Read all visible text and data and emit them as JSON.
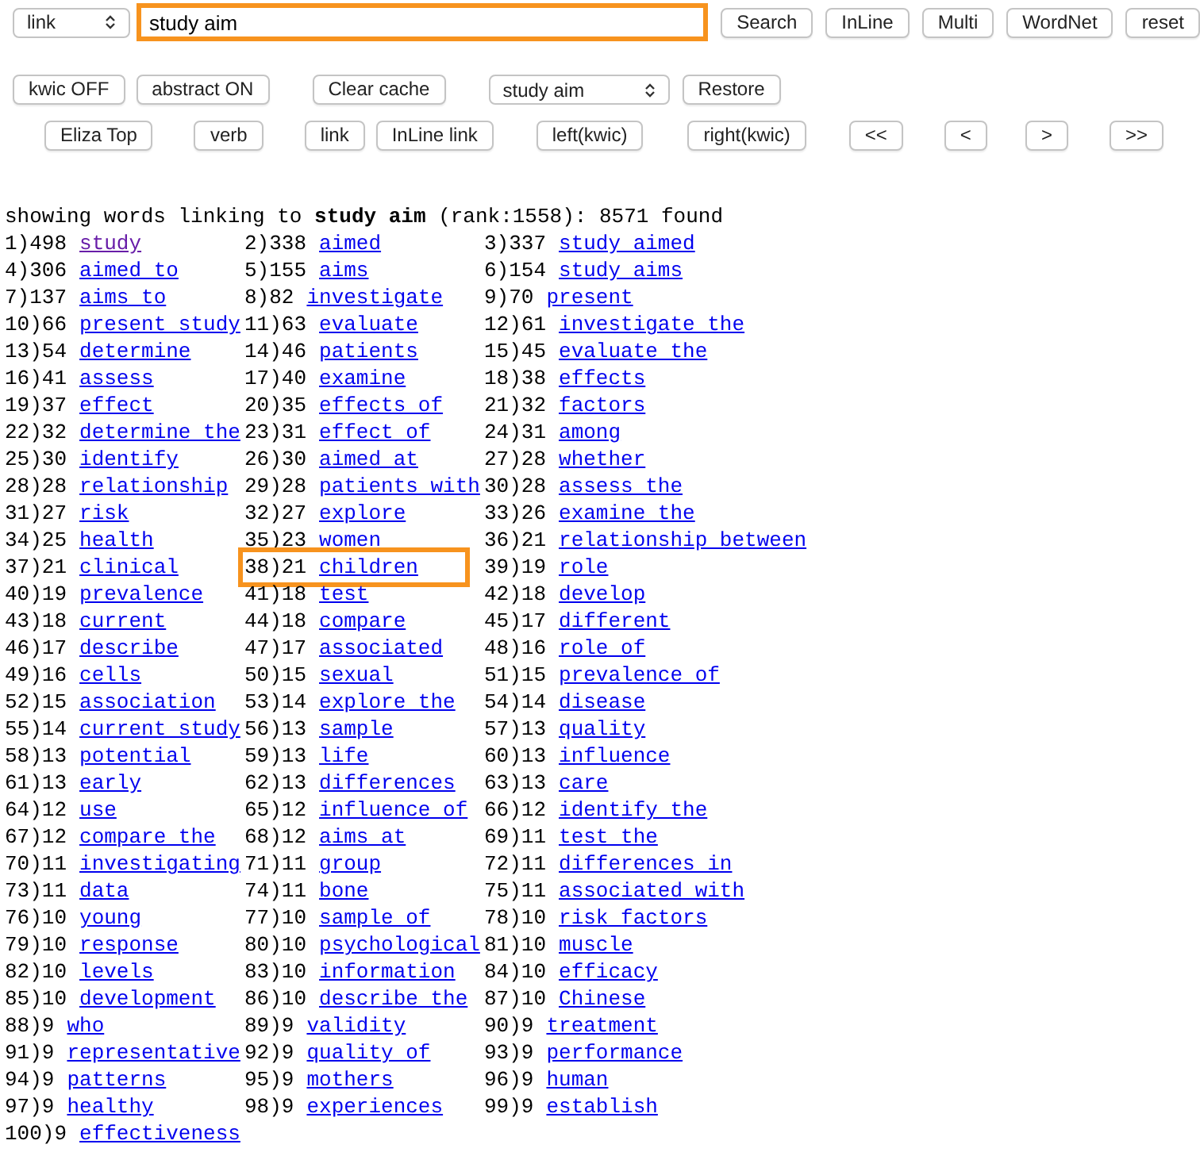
{
  "toolbar": {
    "mode_select": {
      "value": "link"
    },
    "search_field": {
      "value": "study aim",
      "highlighted": true
    },
    "buttons": [
      "Search",
      "InLine",
      "Multi",
      "WordNet",
      "reset"
    ]
  },
  "row2": [
    {
      "kind": "button",
      "label": "kwic OFF"
    },
    {
      "kind": "button",
      "label": "abstract ON"
    },
    {
      "kind": "button",
      "label": "Clear cache"
    },
    {
      "kind": "select",
      "label": "study aim"
    },
    {
      "kind": "button",
      "label": "Restore"
    }
  ],
  "row3": [
    "Eliza Top",
    "verb",
    "link",
    "InLine link",
    "left(kwic)",
    "right(kwic)",
    "<<",
    "<",
    ">",
    ">>"
  ],
  "results": {
    "heading": "showing words linking to **study aim** (rank:1558): 8571 found",
    "items": [
      {
        "num": "1)498",
        "word": "study",
        "visited": true,
        "highlighted": false
      },
      {
        "num": "2)338",
        "word": "aimed",
        "visited": false,
        "highlighted": false
      },
      {
        "num": "3)337",
        "word": "study aimed",
        "visited": false,
        "highlighted": false
      },
      {
        "num": "4)306",
        "word": "aimed to",
        "visited": false,
        "highlighted": false
      },
      {
        "num": "5)155",
        "word": "aims",
        "visited": false,
        "highlighted": false
      },
      {
        "num": "6)154",
        "word": "study aims",
        "visited": false,
        "highlighted": false
      },
      {
        "num": "7)137",
        "word": "aims to",
        "visited": false,
        "highlighted": false
      },
      {
        "num": "8)82",
        "word": "investigate",
        "visited": false,
        "highlighted": false
      },
      {
        "num": "9)70",
        "word": "present",
        "visited": false,
        "highlighted": false
      },
      {
        "num": "10)66",
        "word": "present study",
        "visited": false,
        "highlighted": false
      },
      {
        "num": "11)63",
        "word": "evaluate",
        "visited": false,
        "highlighted": false
      },
      {
        "num": "12)61",
        "word": "investigate the",
        "visited": false,
        "highlighted": false
      },
      {
        "num": "13)54",
        "word": "determine",
        "visited": false,
        "highlighted": false
      },
      {
        "num": "14)46",
        "word": "patients",
        "visited": false,
        "highlighted": false
      },
      {
        "num": "15)45",
        "word": "evaluate the",
        "visited": false,
        "highlighted": false
      },
      {
        "num": "16)41",
        "word": "assess",
        "visited": false,
        "highlighted": false
      },
      {
        "num": "17)40",
        "word": "examine",
        "visited": false,
        "highlighted": false
      },
      {
        "num": "18)38",
        "word": "effects",
        "visited": false,
        "highlighted": false
      },
      {
        "num": "19)37",
        "word": "effect",
        "visited": false,
        "highlighted": false
      },
      {
        "num": "20)35",
        "word": "effects of",
        "visited": false,
        "highlighted": false
      },
      {
        "num": "21)32",
        "word": "factors",
        "visited": false,
        "highlighted": false
      },
      {
        "num": "22)32",
        "word": "determine the",
        "visited": false,
        "highlighted": false
      },
      {
        "num": "23)31",
        "word": "effect of",
        "visited": false,
        "highlighted": false
      },
      {
        "num": "24)31",
        "word": "among",
        "visited": false,
        "highlighted": false
      },
      {
        "num": "25)30",
        "word": "identify",
        "visited": false,
        "highlighted": false
      },
      {
        "num": "26)30",
        "word": "aimed at",
        "visited": false,
        "highlighted": false
      },
      {
        "num": "27)28",
        "word": "whether",
        "visited": false,
        "highlighted": false
      },
      {
        "num": "28)28",
        "word": "relationship",
        "visited": false,
        "highlighted": false
      },
      {
        "num": "29)28",
        "word": "patients with",
        "visited": false,
        "highlighted": false
      },
      {
        "num": "30)28",
        "word": "assess the",
        "visited": false,
        "highlighted": false
      },
      {
        "num": "31)27",
        "word": "risk",
        "visited": false,
        "highlighted": false
      },
      {
        "num": "32)27",
        "word": "explore",
        "visited": false,
        "highlighted": false
      },
      {
        "num": "33)26",
        "word": "examine the",
        "visited": false,
        "highlighted": false
      },
      {
        "num": "34)25",
        "word": "health",
        "visited": false,
        "highlighted": false
      },
      {
        "num": "35)23",
        "word": "women",
        "visited": false,
        "highlighted": false
      },
      {
        "num": "36)21",
        "word": "relationship between",
        "visited": false,
        "highlighted": false
      },
      {
        "num": "37)21",
        "word": "clinical",
        "visited": false,
        "highlighted": false
      },
      {
        "num": "38)21",
        "word": "children",
        "visited": false,
        "highlighted": true
      },
      {
        "num": "39)19",
        "word": "role",
        "visited": false,
        "highlighted": false
      },
      {
        "num": "40)19",
        "word": "prevalence",
        "visited": false,
        "highlighted": false
      },
      {
        "num": "41)18",
        "word": "test",
        "visited": false,
        "highlighted": false
      },
      {
        "num": "42)18",
        "word": "develop",
        "visited": false,
        "highlighted": false
      },
      {
        "num": "43)18",
        "word": "current",
        "visited": false,
        "highlighted": false
      },
      {
        "num": "44)18",
        "word": "compare",
        "visited": false,
        "highlighted": false
      },
      {
        "num": "45)17",
        "word": "different",
        "visited": false,
        "highlighted": false
      },
      {
        "num": "46)17",
        "word": "describe",
        "visited": false,
        "highlighted": false
      },
      {
        "num": "47)17",
        "word": "associated",
        "visited": false,
        "highlighted": false
      },
      {
        "num": "48)16",
        "word": "role of",
        "visited": false,
        "highlighted": false
      },
      {
        "num": "49)16",
        "word": "cells",
        "visited": false,
        "highlighted": false
      },
      {
        "num": "50)15",
        "word": "sexual",
        "visited": false,
        "highlighted": false
      },
      {
        "num": "51)15",
        "word": "prevalence of",
        "visited": false,
        "highlighted": false
      },
      {
        "num": "52)15",
        "word": "association",
        "visited": false,
        "highlighted": false
      },
      {
        "num": "53)14",
        "word": "explore the",
        "visited": false,
        "highlighted": false
      },
      {
        "num": "54)14",
        "word": "disease",
        "visited": false,
        "highlighted": false
      },
      {
        "num": "55)14",
        "word": "current study",
        "visited": false,
        "highlighted": false
      },
      {
        "num": "56)13",
        "word": "sample",
        "visited": false,
        "highlighted": false
      },
      {
        "num": "57)13",
        "word": "quality",
        "visited": false,
        "highlighted": false
      },
      {
        "num": "58)13",
        "word": "potential",
        "visited": false,
        "highlighted": false
      },
      {
        "num": "59)13",
        "word": "life",
        "visited": false,
        "highlighted": false
      },
      {
        "num": "60)13",
        "word": "influence",
        "visited": false,
        "highlighted": false
      },
      {
        "num": "61)13",
        "word": "early",
        "visited": false,
        "highlighted": false
      },
      {
        "num": "62)13",
        "word": "differences",
        "visited": false,
        "highlighted": false
      },
      {
        "num": "63)13",
        "word": "care",
        "visited": false,
        "highlighted": false
      },
      {
        "num": "64)12",
        "word": "use",
        "visited": false,
        "highlighted": false
      },
      {
        "num": "65)12",
        "word": "influence of",
        "visited": false,
        "highlighted": false
      },
      {
        "num": "66)12",
        "word": "identify the",
        "visited": false,
        "highlighted": false
      },
      {
        "num": "67)12",
        "word": "compare the",
        "visited": false,
        "highlighted": false
      },
      {
        "num": "68)12",
        "word": "aims at",
        "visited": false,
        "highlighted": false
      },
      {
        "num": "69)11",
        "word": "test the",
        "visited": false,
        "highlighted": false
      },
      {
        "num": "70)11",
        "word": "investigating",
        "visited": false,
        "highlighted": false
      },
      {
        "num": "71)11",
        "word": "group",
        "visited": false,
        "highlighted": false
      },
      {
        "num": "72)11",
        "word": "differences in",
        "visited": false,
        "highlighted": false
      },
      {
        "num": "73)11",
        "word": "data",
        "visited": false,
        "highlighted": false
      },
      {
        "num": "74)11",
        "word": "bone",
        "visited": false,
        "highlighted": false
      },
      {
        "num": "75)11",
        "word": "associated with",
        "visited": false,
        "highlighted": false
      },
      {
        "num": "76)10",
        "word": "young",
        "visited": false,
        "highlighted": false
      },
      {
        "num": "77)10",
        "word": "sample of",
        "visited": false,
        "highlighted": false
      },
      {
        "num": "78)10",
        "word": "risk factors",
        "visited": false,
        "highlighted": false
      },
      {
        "num": "79)10",
        "word": "response",
        "visited": false,
        "highlighted": false
      },
      {
        "num": "80)10",
        "word": "psychological",
        "visited": false,
        "highlighted": false
      },
      {
        "num": "81)10",
        "word": "muscle",
        "visited": false,
        "highlighted": false
      },
      {
        "num": "82)10",
        "word": "levels",
        "visited": false,
        "highlighted": false
      },
      {
        "num": "83)10",
        "word": "information",
        "visited": false,
        "highlighted": false
      },
      {
        "num": "84)10",
        "word": "efficacy",
        "visited": false,
        "highlighted": false
      },
      {
        "num": "85)10",
        "word": "development",
        "visited": false,
        "highlighted": false
      },
      {
        "num": "86)10",
        "word": "describe the",
        "visited": false,
        "highlighted": false
      },
      {
        "num": "87)10",
        "word": "Chinese",
        "visited": false,
        "highlighted": false
      },
      {
        "num": "88)9",
        "word": "who",
        "visited": false,
        "highlighted": false
      },
      {
        "num": "89)9",
        "word": "validity",
        "visited": false,
        "highlighted": false
      },
      {
        "num": "90)9",
        "word": "treatment",
        "visited": false,
        "highlighted": false
      },
      {
        "num": "91)9",
        "word": "representative",
        "visited": false,
        "highlighted": false
      },
      {
        "num": "92)9",
        "word": "quality of",
        "visited": false,
        "highlighted": false
      },
      {
        "num": "93)9",
        "word": "performance",
        "visited": false,
        "highlighted": false
      },
      {
        "num": "94)9",
        "word": "patterns",
        "visited": false,
        "highlighted": false
      },
      {
        "num": "95)9",
        "word": "mothers",
        "visited": false,
        "highlighted": false
      },
      {
        "num": "96)9",
        "word": "human",
        "visited": false,
        "highlighted": false
      },
      {
        "num": "97)9",
        "word": "healthy",
        "visited": false,
        "highlighted": false
      },
      {
        "num": "98)9",
        "word": "experiences",
        "visited": false,
        "highlighted": false
      },
      {
        "num": "99)9",
        "word": "establish",
        "visited": false,
        "highlighted": false
      },
      {
        "num": "100)9",
        "word": "effectiveness",
        "visited": false,
        "highlighted": false
      }
    ]
  }
}
